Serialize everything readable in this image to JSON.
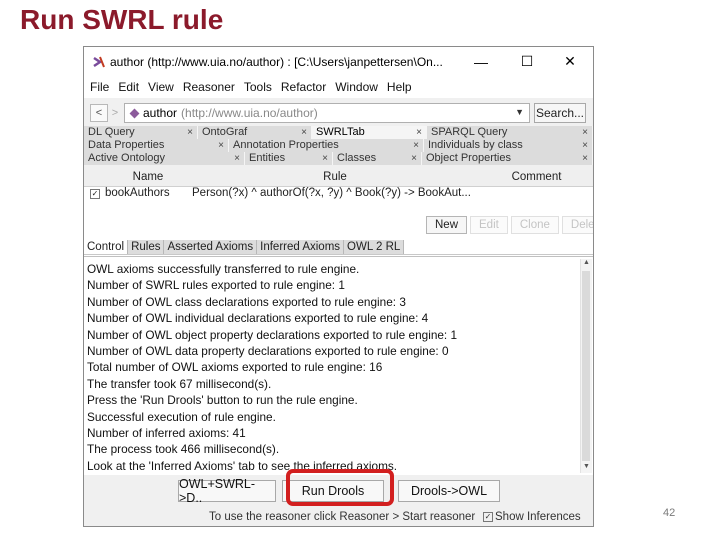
{
  "slide": {
    "title": "Run SWRL rule",
    "page_number": "42"
  },
  "window": {
    "title": "author (http://www.uia.no/author) : [C:\\Users\\janpettersen\\On...",
    "controls": {
      "minimize": "—",
      "maximize": "☐",
      "close": "✕"
    }
  },
  "menu": [
    "File",
    "Edit",
    "View",
    "Reasoner",
    "Tools",
    "Refactor",
    "Window",
    "Help"
  ],
  "address": {
    "back": "<",
    "forward": ">",
    "entity_name": "author",
    "entity_iri": "(http://www.uia.no/author)",
    "dropdown_arrow": "▼",
    "search_label": "Search..."
  },
  "tab_rows": [
    [
      {
        "label": "DL Query",
        "active": false
      },
      {
        "label": "OntoGraf",
        "active": false
      },
      {
        "label": "SWRLTab",
        "active": true
      },
      {
        "label": "SPARQL Query",
        "active": false
      }
    ],
    [
      {
        "label": "Data Properties",
        "active": false
      },
      {
        "label": "Annotation Properties",
        "active": false
      },
      {
        "label": "Individuals by class",
        "active": false
      }
    ],
    [
      {
        "label": "Active Ontology",
        "active": false
      },
      {
        "label": "Entities",
        "active": false
      },
      {
        "label": "Classes",
        "active": false
      },
      {
        "label": "Object Properties",
        "active": false
      }
    ]
  ],
  "tab_close": "×",
  "rules_table": {
    "headers": {
      "name": "Name",
      "rule": "Rule",
      "comment": "Comment"
    },
    "rows": [
      {
        "enabled": "✓",
        "name": "bookAuthors",
        "rule": "Person(?x) ^ authorOf(?x, ?y) ^ Book(?y) -> BookAut...",
        "comment": ""
      }
    ]
  },
  "rule_buttons": {
    "new": "New",
    "edit": "Edit",
    "clone": "Clone",
    "delete": "Delete"
  },
  "control_tabs": [
    {
      "label": "Control",
      "active": true
    },
    {
      "label": "Rules",
      "active": false
    },
    {
      "label": "Asserted Axioms",
      "active": false
    },
    {
      "label": "Inferred Axioms",
      "active": false
    },
    {
      "label": "OWL 2 RL",
      "active": false
    }
  ],
  "console": [
    "OWL axioms successfully transferred to rule engine.",
    "Number of SWRL rules exported to rule engine: 1",
    "Number of OWL class declarations exported to rule engine: 3",
    "Number of OWL individual declarations exported to rule engine: 4",
    "Number of OWL object property declarations exported to rule engine: 1",
    "Number of OWL data property declarations exported to rule engine: 0",
    "Total number of OWL axioms exported to rule engine: 16",
    "The transfer took 67 millisecond(s).",
    "Press the 'Run Drools' button to run the rule engine.",
    "Successful execution of rule engine.",
    "Number of inferred axioms: 41",
    "The process took 466 millisecond(s).",
    "Look at the 'Inferred Axioms' tab to see the inferred axioms."
  ],
  "scroll": {
    "up": "▲",
    "down": "▼"
  },
  "action_buttons": {
    "owl_swrl_to_drools": "OWL+SWRL->D..",
    "run_drools": "Run Drools",
    "drools_to_owl": "Drools->OWL"
  },
  "status": {
    "text": "To use the reasoner click Reasoner > Start reasoner",
    "show_inferences_checked": "✓",
    "show_inferences": "Show Inferences"
  }
}
